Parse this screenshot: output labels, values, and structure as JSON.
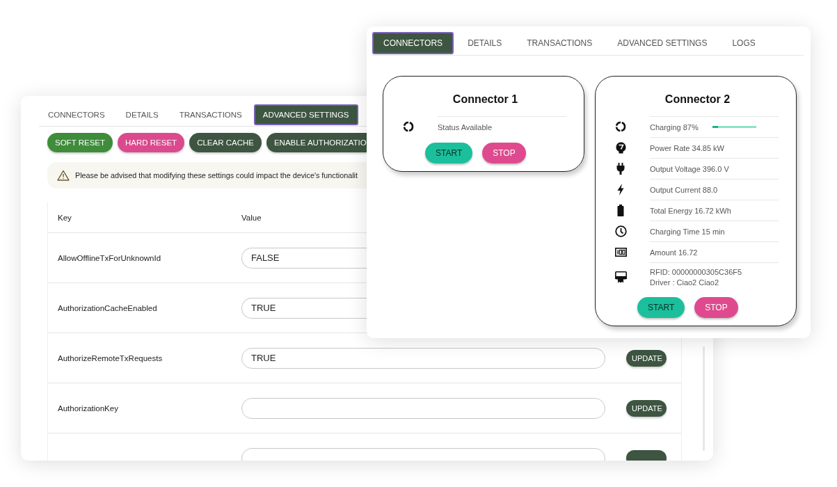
{
  "settings_window": {
    "tabs": [
      {
        "label": "CONNECTORS",
        "selected": false
      },
      {
        "label": "DETAILS",
        "selected": false
      },
      {
        "label": "TRANSACTIONS",
        "selected": false
      },
      {
        "label": "ADVANCED SETTINGS",
        "selected": true
      }
    ],
    "actions": [
      "SOFT RESET",
      "HARD RESET",
      "CLEAR CACHE",
      "ENABLE AUTHORIZATIO"
    ],
    "warning": "Please be advised that modifying these settings could impact the device's functionalit",
    "table": {
      "columns": [
        "Key",
        "Value"
      ],
      "rows": [
        {
          "key": "AllowOfflineTxForUnknownId",
          "value": "FALSE"
        },
        {
          "key": "AuthorizationCacheEnabled",
          "value": "TRUE"
        },
        {
          "key": "AuthorizeRemoteTxRequests",
          "value": "TRUE",
          "button": "UPDATE"
        },
        {
          "key": "AuthorizationKey",
          "button": "UPDATE"
        }
      ]
    }
  },
  "connectors_window": {
    "tabs": [
      {
        "label": "CONNECTORS",
        "selected": true
      },
      {
        "label": "DETAILS",
        "selected": false
      },
      {
        "label": "TRANSACTIONS",
        "selected": false
      },
      {
        "label": "ADVANCED SETTINGS",
        "selected": false
      },
      {
        "label": "LOGS",
        "selected": false
      }
    ],
    "cards": [
      {
        "title": "Connector 1",
        "rows": [
          {
            "kind": "status",
            "text": "Status Available"
          }
        ],
        "buttons": [
          "START",
          "STOP"
        ]
      },
      {
        "title": "Connector 2",
        "rows": [
          {
            "kind": "status",
            "text": "Charging 87%",
            "level": 0.13
          },
          {
            "kind": "power",
            "text": "Power Rate 34.85 kW"
          },
          {
            "kind": "voltage",
            "text": "Output Voltage 396.0 V"
          },
          {
            "kind": "current",
            "text": "Output Current 88.0"
          },
          {
            "kind": "energy",
            "text": "Total Energy 16.72 kWh"
          },
          {
            "kind": "time",
            "text": "Charging Time 15 min"
          },
          {
            "kind": "amount",
            "text": "Amount 16.72"
          },
          {
            "kind": "rfid",
            "text": "RFID: 00000000305C36F5",
            "subtext": "Driver : Ciao2 Ciao2"
          }
        ],
        "buttons": [
          "START",
          "STOP"
        ]
      }
    ]
  }
}
